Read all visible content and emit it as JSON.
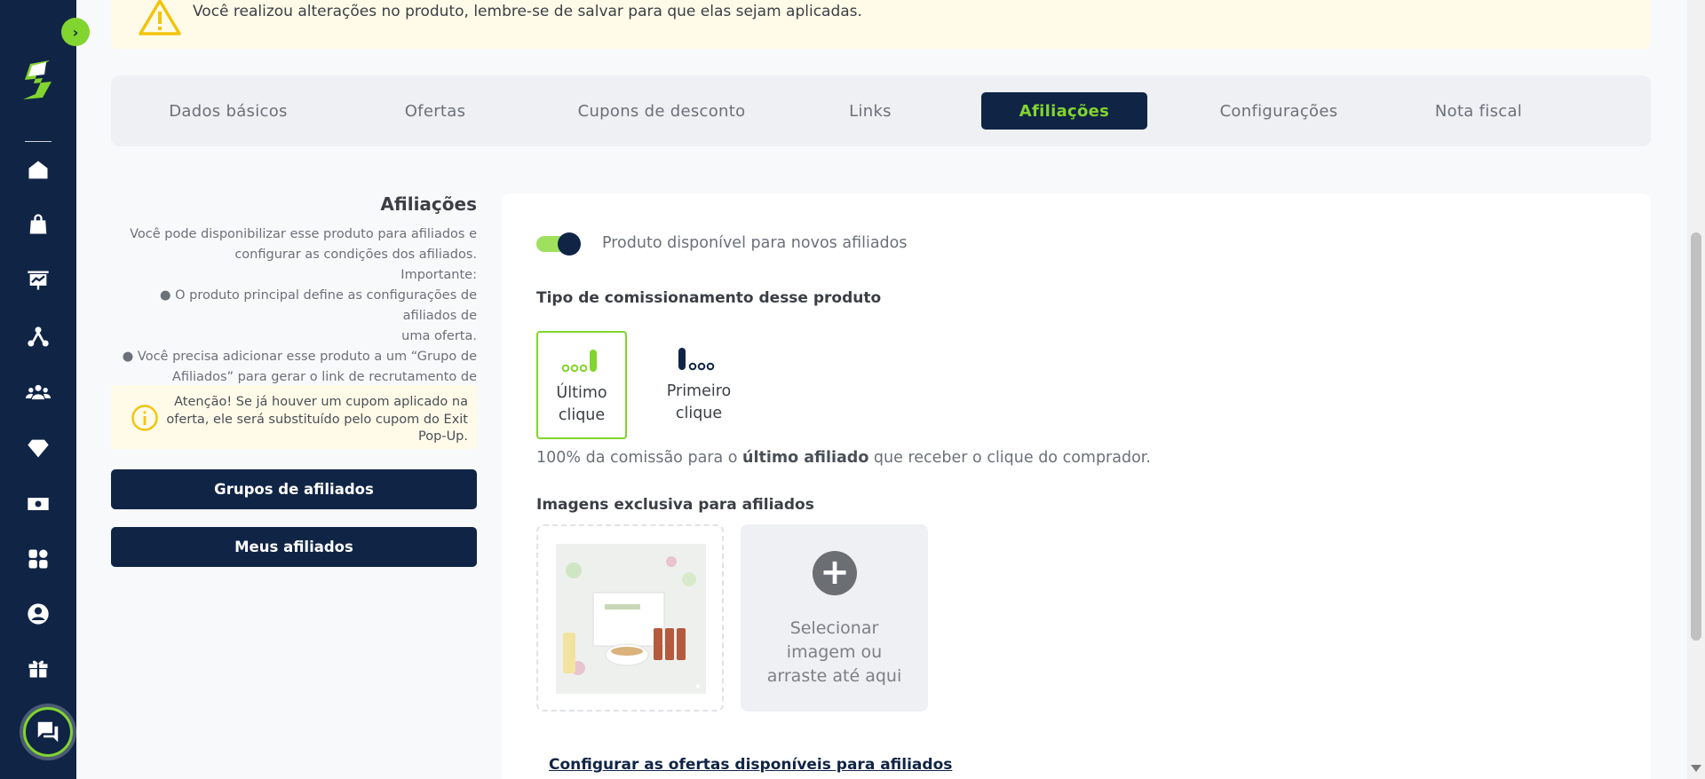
{
  "banner": {
    "message": "Você realizou alterações no produto, lembre-se de salvar para que elas sejam aplicadas."
  },
  "tabs": [
    {
      "label": "Dados básicos",
      "active": false
    },
    {
      "label": "Ofertas",
      "active": false
    },
    {
      "label": "Cupons de desconto",
      "active": false
    },
    {
      "label": "Links",
      "active": false
    },
    {
      "label": "Afiliações",
      "active": true
    },
    {
      "label": "Configurações",
      "active": false
    },
    {
      "label": "Nota fiscal",
      "active": false
    }
  ],
  "left": {
    "title": "Afiliações",
    "desc_lines": [
      "Você pode disponibilizar esse produto para afiliados e",
      "configurar as condições dos afiliados.",
      "Importante:",
      "● O produto principal define as configurações de afiliados de",
      "uma oferta.",
      "● Você precisa adicionar esse produto a um “Grupo de",
      "Afiliados” para gerar o link de recrutamento de afiliados."
    ],
    "notice": "Atenção! Se já houver um cupom aplicado na oferta, ele será substituído pelo cupom do Exit Pop-Up.",
    "btn_groups": "Grupos de afiliados",
    "btn_affiliates": "Meus afiliados"
  },
  "main": {
    "toggle_label": "Produto disponível para novos afiliados",
    "toggle_on": true,
    "commission_title": "Tipo de comissionamento desse produto",
    "options": [
      {
        "line1": "Último",
        "line2": "clique",
        "selected": true
      },
      {
        "line1": "Primeiro",
        "line2": "clique",
        "selected": false
      }
    ],
    "commission_pre": "100% da comissão para o ",
    "commission_bold": "último afiliado",
    "commission_post": " que receber o clique do comprador.",
    "images_title": "Imagens exclusiva para afiliados",
    "upload_line1": "Selecionar",
    "upload_line2": "imagem ou",
    "upload_line3": "arraste até aqui",
    "config_link": "Configurar as ofertas disponíveis para afiliados"
  },
  "colors": {
    "navy": "#102446",
    "lime": "#82d42e",
    "warning_bg": "#fffbe8"
  },
  "icons": {
    "sidebar": [
      "home-icon",
      "shopping-bag-icon",
      "presentation-chart-icon",
      "network-icon",
      "users-group-icon",
      "diamond-icon",
      "money-icon",
      "apps-grid-icon",
      "user-circle-icon",
      "gift-icon"
    ],
    "chat": "chat-icon"
  }
}
